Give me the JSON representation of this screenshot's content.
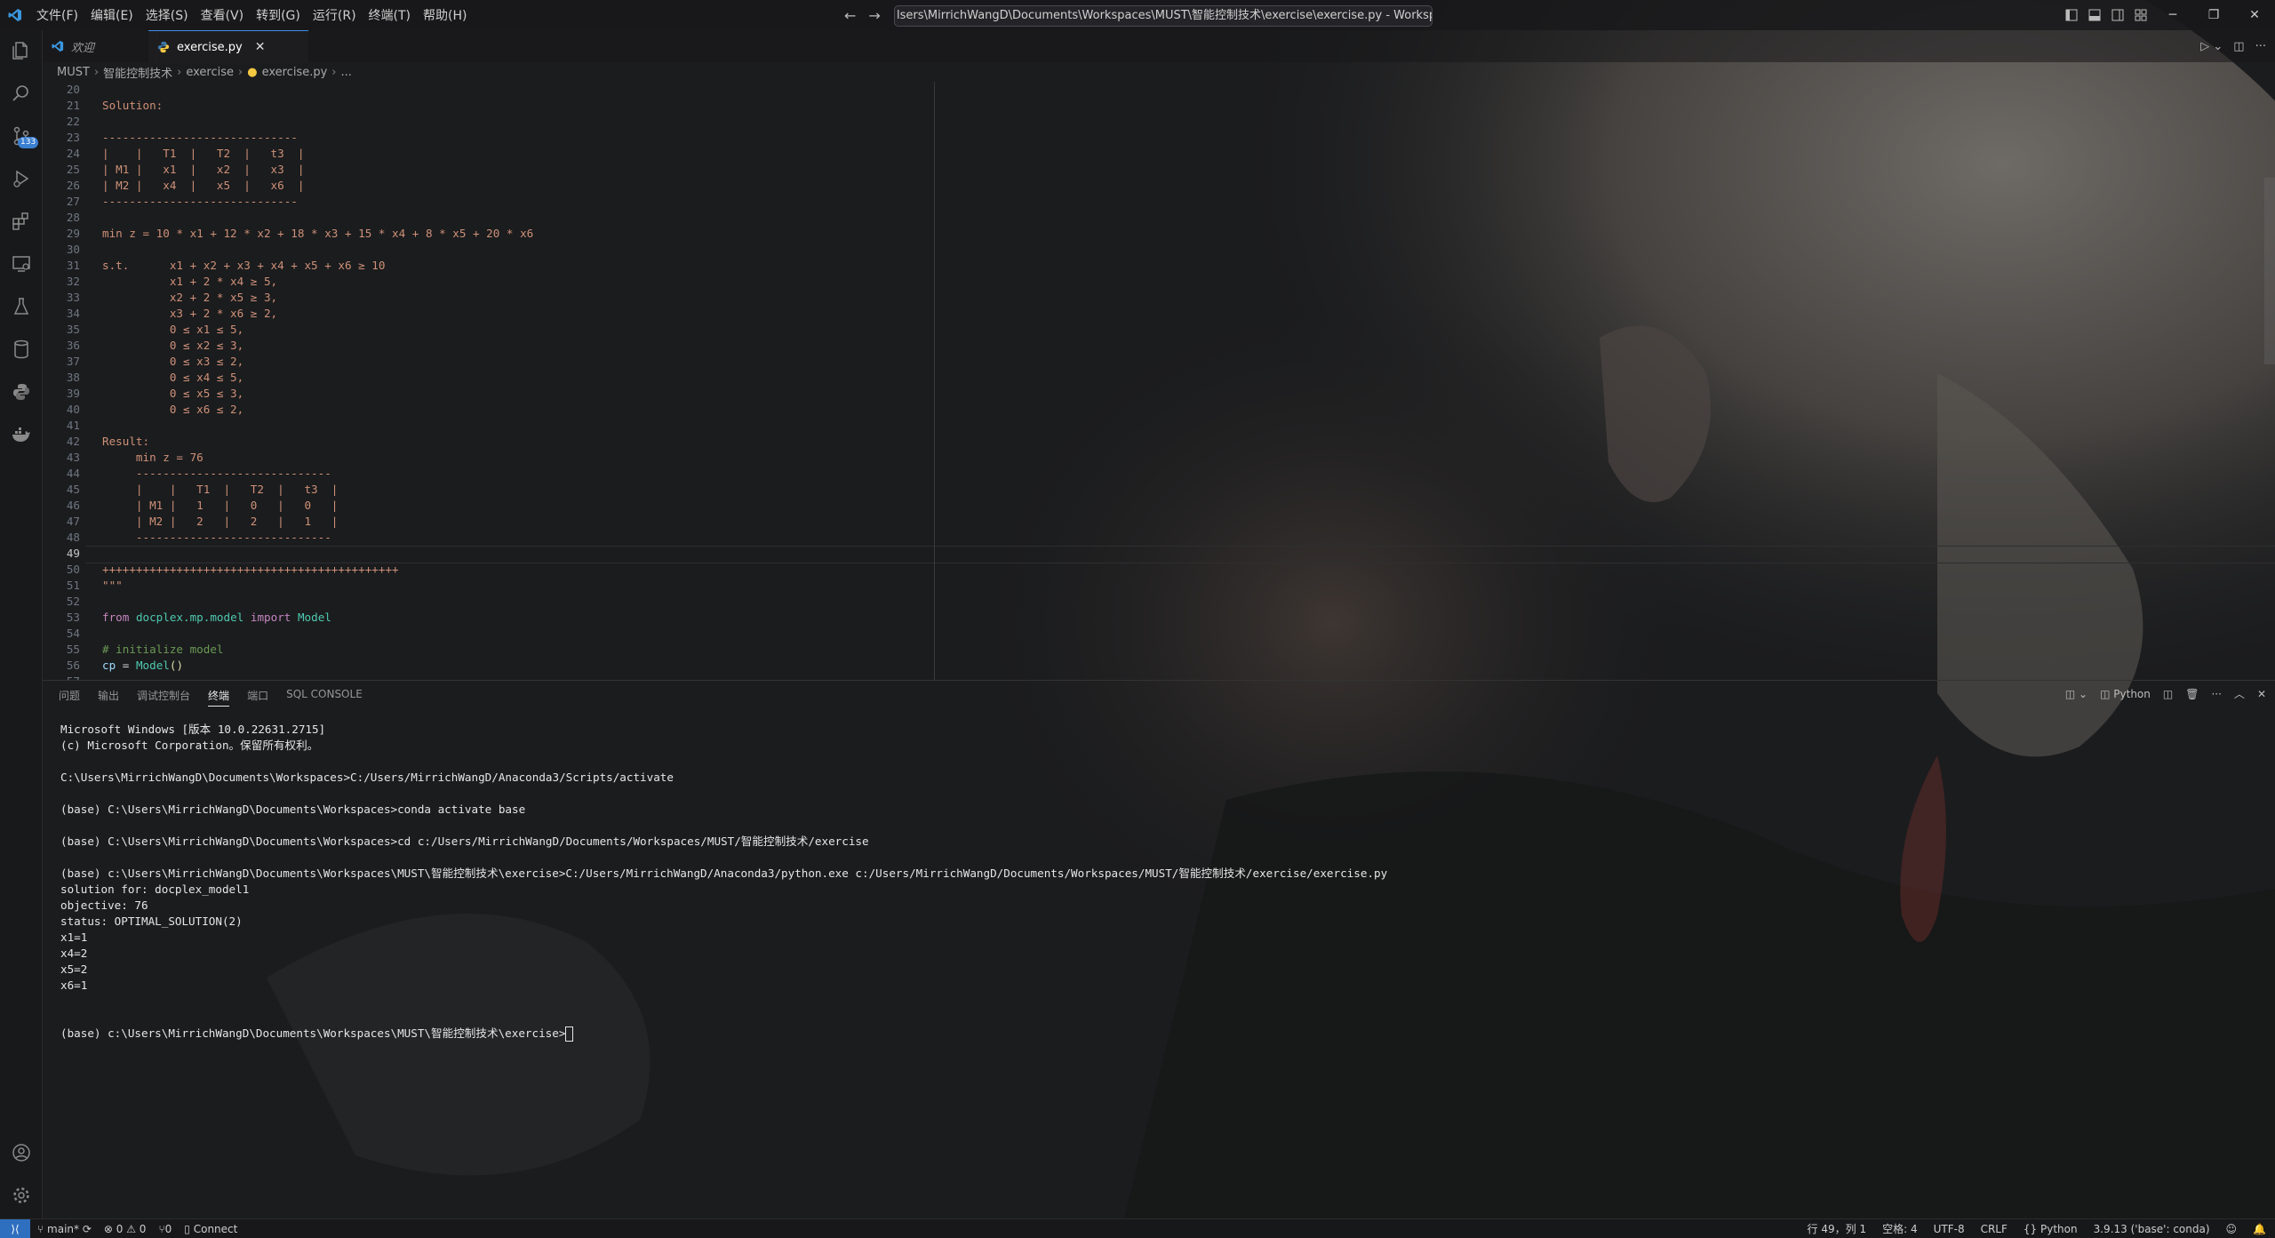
{
  "titlebar": {
    "menu": [
      "文件(F)",
      "编辑(E)",
      "选择(S)",
      "查看(V)",
      "转到(G)",
      "运行(R)",
      "终端(T)",
      "帮助(H)"
    ],
    "search_text": "lsers\\MirrichWangD\\Documents\\Workspaces\\MUST\\智能控制技术\\exercise\\exercise.py - Workspaces - Visual Studi"
  },
  "activitybar": {
    "source_control_badge": "133"
  },
  "tabs": [
    {
      "label": "欢迎"
    },
    {
      "label": "exercise.py"
    }
  ],
  "breadcrumb": [
    "MUST",
    "智能控制技术",
    "exercise",
    "exercise.py",
    "..."
  ],
  "editor": {
    "lines": [
      {
        "n": "20",
        "t": ""
      },
      {
        "n": "21",
        "t": "Solution:"
      },
      {
        "n": "22",
        "t": ""
      },
      {
        "n": "23",
        "t": "-----------------------------"
      },
      {
        "n": "24",
        "t": "|    |   T1  |   T2  |   t3  |"
      },
      {
        "n": "25",
        "t": "| M1 |   x1  |   x2  |   x3  |"
      },
      {
        "n": "26",
        "t": "| M2 |   x4  |   x5  |   x6  |"
      },
      {
        "n": "27",
        "t": "-----------------------------"
      },
      {
        "n": "28",
        "t": ""
      },
      {
        "n": "29",
        "t": "min z = 10 * x1 + 12 * x2 + 18 * x3 + 15 * x4 + 8 * x5 + 20 * x6"
      },
      {
        "n": "30",
        "t": ""
      },
      {
        "n": "31",
        "t": "s.t.      x1 + x2 + x3 + x4 + x5 + x6 ≥ 10"
      },
      {
        "n": "32",
        "t": "          x1 + 2 * x4 ≥ 5,"
      },
      {
        "n": "33",
        "t": "          x2 + 2 * x5 ≥ 3,"
      },
      {
        "n": "34",
        "t": "          x3 + 2 * x6 ≥ 2,"
      },
      {
        "n": "35",
        "t": "          0 ≤ x1 ≤ 5,"
      },
      {
        "n": "36",
        "t": "          0 ≤ x2 ≤ 3,"
      },
      {
        "n": "37",
        "t": "          0 ≤ x3 ≤ 2,"
      },
      {
        "n": "38",
        "t": "          0 ≤ x4 ≤ 5,"
      },
      {
        "n": "39",
        "t": "          0 ≤ x5 ≤ 3,"
      },
      {
        "n": "40",
        "t": "          0 ≤ x6 ≤ 2,"
      },
      {
        "n": "41",
        "t": ""
      },
      {
        "n": "42",
        "t": "Result:"
      },
      {
        "n": "43",
        "t": "     min z = 76"
      },
      {
        "n": "44",
        "t": "     -----------------------------"
      },
      {
        "n": "45",
        "t": "     |    |   T1  |   T2  |   t3  |"
      },
      {
        "n": "46",
        "t": "     | M1 |   1   |   0   |   0   |"
      },
      {
        "n": "47",
        "t": "     | M2 |   2   |   2   |   1   |"
      },
      {
        "n": "48",
        "t": "     -----------------------------"
      },
      {
        "n": "49",
        "t": ""
      },
      {
        "n": "50",
        "t": "++++++++++++++++++++++++++++++++++++++++++++"
      },
      {
        "n": "51",
        "t": "\"\"\""
      },
      {
        "n": "52",
        "t": ""
      },
      {
        "n": "53",
        "t": "from docplex.mp.model import Model"
      },
      {
        "n": "54",
        "t": ""
      },
      {
        "n": "55",
        "t": "# initialize model"
      },
      {
        "n": "56",
        "t": "cp = Model()"
      },
      {
        "n": "57",
        "t": ""
      }
    ]
  },
  "panel": {
    "tabs": [
      "问题",
      "输出",
      "调试控制台",
      "终端",
      "端口",
      "SQL CONSOLE"
    ],
    "active_tab": "终端",
    "terminal_profile": "Python",
    "terminal_lines": [
      "Microsoft Windows [版本 10.0.22631.2715]",
      "(c) Microsoft Corporation。保留所有权利。",
      "",
      "C:\\Users\\MirrichWangD\\Documents\\Workspaces>C:/Users/MirrichWangD/Anaconda3/Scripts/activate",
      "",
      "(base) C:\\Users\\MirrichWangD\\Documents\\Workspaces>conda activate base",
      "",
      "(base) C:\\Users\\MirrichWangD\\Documents\\Workspaces>cd c:/Users/MirrichWangD/Documents/Workspaces/MUST/智能控制技术/exercise",
      "",
      "(base) c:\\Users\\MirrichWangD\\Documents\\Workspaces\\MUST\\智能控制技术\\exercise>C:/Users/MirrichWangD/Anaconda3/python.exe c:/Users/MirrichWangD/Documents/Workspaces/MUST/智能控制技术/exercise/exercise.py",
      "solution for: docplex_model1",
      "objective: 76",
      "status: OPTIMAL_SOLUTION(2)",
      "x1=1",
      "x4=2",
      "x5=2",
      "x6=1",
      "",
      ""
    ],
    "prompt": "(base) c:\\Users\\MirrichWangD\\Documents\\Workspaces\\MUST\\智能控制技术\\exercise>"
  },
  "statusbar": {
    "branch": "main*",
    "problems": "⊗ 0 ⚠ 0",
    "ports": "⑂0",
    "connect": "Connect",
    "position": "行 49，列 1",
    "spaces": "空格: 4",
    "encoding": "UTF-8",
    "eol": "CRLF",
    "language": "Python",
    "interpreter": "3.9.13 ('base': conda)"
  }
}
